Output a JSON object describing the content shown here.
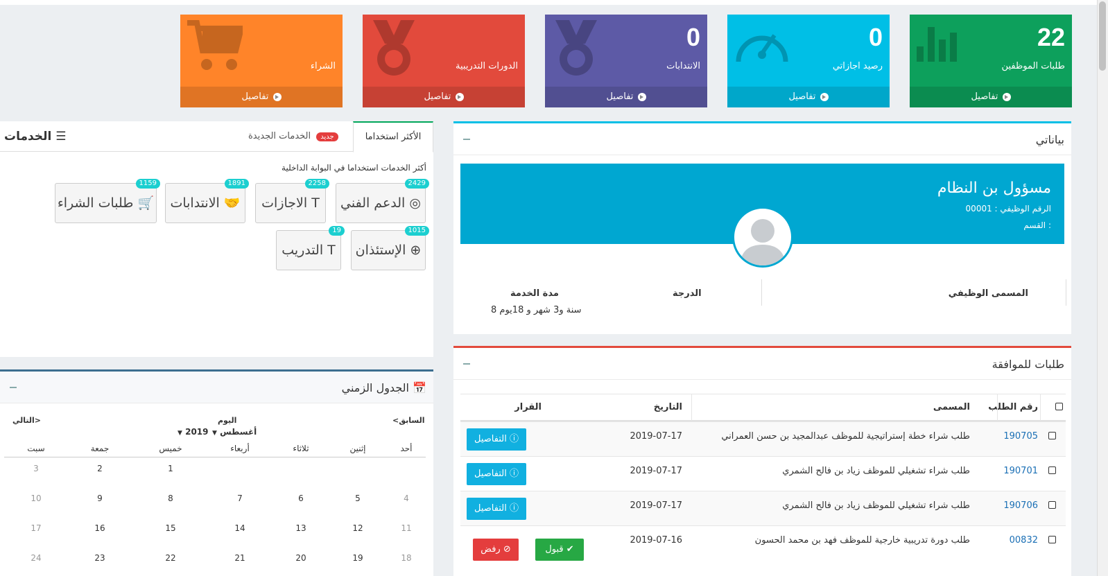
{
  "tiles": [
    {
      "value": "22",
      "label": "طلبات الموظفين",
      "footer": "تفاصيل",
      "color": "#0da05c"
    },
    {
      "value": "0",
      "label": "رصيد اجازاتي",
      "footer": "تفاصيل",
      "color": "#00bfe6"
    },
    {
      "value": "0",
      "label": "الانتدابات",
      "footer": "تفاصيل",
      "color": "#5d5aa6"
    },
    {
      "value": "",
      "label": "الدورات التدريبية",
      "footer": "تفاصيل",
      "color": "#e24a3c"
    },
    {
      "value": "",
      "label": "الشراء",
      "footer": "تفاصيل",
      "color": "#ff8429"
    }
  ],
  "profile": {
    "title": "بياناتي",
    "name": "مسؤول بن النظام",
    "employee_number": "الرقم الوظيفي : 00001",
    "department": "القسم :",
    "job_title_label": "المسمى الوظيفي",
    "grade_label": "الدرجة",
    "service_label": "مدة الخدمة",
    "service_value": "8 سنة و3 شهر و 18يوم"
  },
  "approvals": {
    "title": "طلبات للموافقة",
    "headers": {
      "number": "رقم الطلب",
      "name": "المسمى",
      "date": "التاريخ",
      "decision": "القرار"
    },
    "rows": [
      {
        "number": "190705",
        "name": "طلب شراء خطة إستراتيجية للموظف عبدالمجيد بن حسن العمراني",
        "date": "2019-07-17",
        "action": "التفاصيل"
      },
      {
        "number": "190701",
        "name": "طلب شراء تشغيلي للموظف زياد بن فالح الشمري",
        "date": "2019-07-17",
        "action": "التفاصيل"
      },
      {
        "number": "190706",
        "name": "طلب شراء تشغيلي للموظف زياد بن فالح الشمري",
        "date": "2019-07-17",
        "action": "التفاصيل"
      },
      {
        "number": "00832",
        "name": "طلب دورة تدريبية خارجية للموظف فهد بن محمد الحسون",
        "date": "2019-07-16",
        "accept": "قبول",
        "reject": "رفض"
      }
    ]
  },
  "services": {
    "title": "الخدمات",
    "tab_most_used": "الأكثر استخداما",
    "tab_new": "الخدمات الجديدة",
    "new_badge": "جديد",
    "subtitle": "أكثر الخدمات استخداما في البوابة الداخلية",
    "items": [
      {
        "label": "الدعم الفني",
        "count": "2429"
      },
      {
        "label": "الاجازات",
        "count": "2258"
      },
      {
        "label": "الانتدابات",
        "count": "1891"
      },
      {
        "label": "طلبات الشراء",
        "count": "1159"
      },
      {
        "label": "الإستئذان",
        "count": "1015"
      },
      {
        "label": "التدريب",
        "count": "19"
      }
    ]
  },
  "calendar": {
    "title": "الجدول الزمني",
    "prev": "السابق",
    "next": "التالي",
    "today": "اليوم",
    "month": "أغسطس",
    "year": "2019",
    "weekdays": [
      "أحد",
      "إثنين",
      "ثلاثاء",
      "أربعاء",
      "خميس",
      "جمعة",
      "سبت"
    ],
    "weeks": [
      [
        "",
        "",
        "",
        "",
        "1",
        "2",
        "3"
      ],
      [
        "4",
        "5",
        "6",
        "7",
        "8",
        "9",
        "10"
      ],
      [
        "11",
        "12",
        "13",
        "14",
        "15",
        "16",
        "17"
      ],
      [
        "18",
        "19",
        "20",
        "21",
        "22",
        "23",
        "24"
      ]
    ]
  }
}
